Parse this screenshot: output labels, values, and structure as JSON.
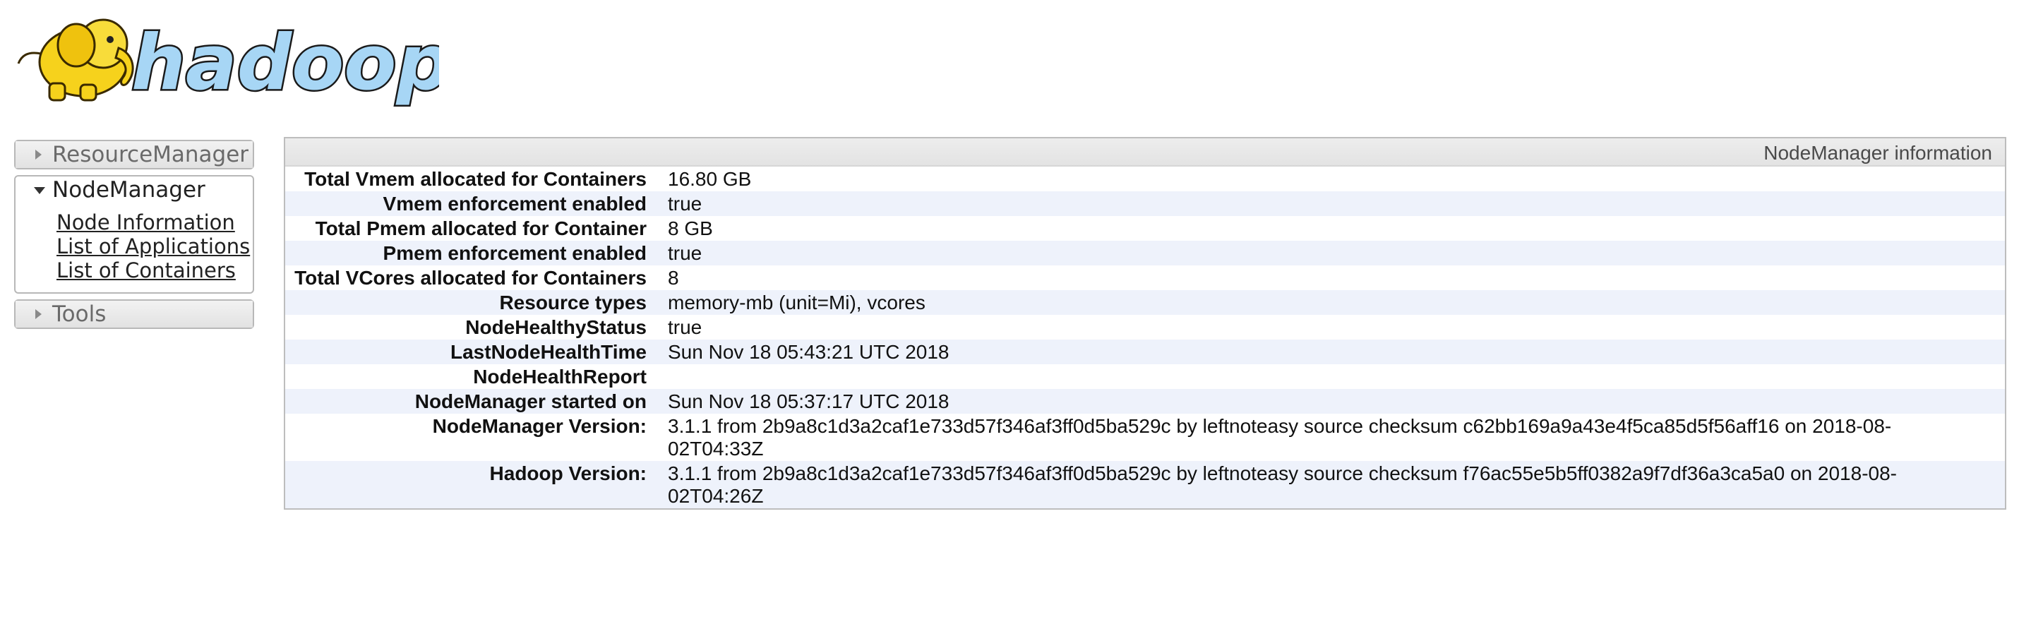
{
  "logo": {
    "text": "hadoop",
    "colors": {
      "elephant": "#f6d21c",
      "text_fill": "#a7d6f5",
      "text_stroke": "#1a1a1a"
    }
  },
  "nav": {
    "sections": [
      {
        "label": "ResourceManager",
        "state": "collapsed"
      },
      {
        "label": "NodeManager",
        "state": "expanded",
        "links": [
          "Node Information",
          "List of Applications",
          "List of Containers"
        ]
      },
      {
        "label": "Tools",
        "state": "collapsed"
      }
    ]
  },
  "info": {
    "title": "NodeManager information",
    "rows": [
      {
        "key": "Total Vmem allocated for Containers",
        "value": "16.80 GB"
      },
      {
        "key": "Vmem enforcement enabled",
        "value": "true"
      },
      {
        "key": "Total Pmem allocated for Container",
        "value": "8 GB"
      },
      {
        "key": "Pmem enforcement enabled",
        "value": "true"
      },
      {
        "key": "Total VCores allocated for Containers",
        "value": "8"
      },
      {
        "key": "Resource types",
        "value": "memory-mb (unit=Mi), vcores"
      },
      {
        "key": "NodeHealthyStatus",
        "value": "true"
      },
      {
        "key": "LastNodeHealthTime",
        "value": "Sun Nov 18 05:43:21 UTC 2018"
      },
      {
        "key": "NodeHealthReport",
        "value": ""
      },
      {
        "key": "NodeManager started on",
        "value": "Sun Nov 18 05:37:17 UTC 2018"
      },
      {
        "key": "NodeManager Version:",
        "value": "3.1.1 from 2b9a8c1d3a2caf1e733d57f346af3ff0d5ba529c by leftnoteasy source checksum c62bb169a9a43e4f5ca85d5f56aff16 on 2018-08-02T04:33Z"
      },
      {
        "key": "Hadoop Version:",
        "value": "3.1.1 from 2b9a8c1d3a2caf1e733d57f346af3ff0d5ba529c by leftnoteasy source checksum f76ac55e5b5ff0382a9f7df36a3ca5a0 on 2018-08-02T04:26Z"
      }
    ]
  },
  "colors": {
    "row_alt": "#eef2fb",
    "header_bg": "#e8e8e8",
    "border": "#bdbdbd"
  }
}
